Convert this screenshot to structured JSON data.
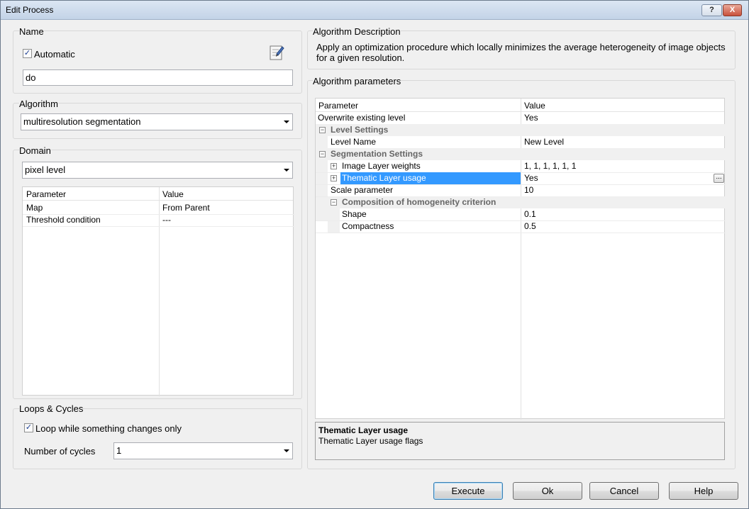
{
  "window": {
    "title": "Edit Process",
    "help_label": "?",
    "close_label": "X"
  },
  "name_section": {
    "label": "Name",
    "automatic_label": "Automatic",
    "automatic_checked": true,
    "name_value": "do",
    "edit_icon": "edit-document-icon"
  },
  "algorithm_section": {
    "label": "Algorithm",
    "selected": "multiresolution segmentation"
  },
  "domain_section": {
    "label": "Domain",
    "selected": "pixel level",
    "grid": {
      "headers": [
        "Parameter",
        "Value"
      ],
      "rows": [
        [
          "Map",
          "From Parent"
        ],
        [
          "Threshold condition",
          "---"
        ]
      ]
    }
  },
  "loops_section": {
    "label": "Loops & Cycles",
    "loop_label": "Loop while something changes only",
    "loop_checked": true,
    "cycles_label": "Number of cycles",
    "cycles_value": "1"
  },
  "description_section": {
    "label": "Algorithm Description",
    "text": "Apply an optimization procedure which locally minimizes the average heterogeneity of image objects for a given resolution."
  },
  "parameters_section": {
    "label": "Algorithm parameters",
    "headers": [
      "Parameter",
      "Value"
    ],
    "rows": [
      {
        "name": "Overwrite existing level",
        "value": "Yes"
      },
      {
        "name": "Level Settings",
        "value": ""
      },
      {
        "name": "Level Name",
        "value": "New Level"
      },
      {
        "name": "Segmentation Settings",
        "value": ""
      },
      {
        "name": "Image Layer weights",
        "value": "1, 1, 1, 1, 1, 1"
      },
      {
        "name": "Thematic Layer usage",
        "value": "Yes"
      },
      {
        "name": "Scale parameter",
        "value": "10"
      },
      {
        "name": "Composition of homogeneity criterion",
        "value": ""
      },
      {
        "name": "Shape",
        "value": "0.1"
      },
      {
        "name": "Compactness",
        "value": "0.5"
      }
    ],
    "selected_row": "Thematic Layer usage",
    "ellipsis_label": "...",
    "help_title": "Thematic Layer usage",
    "help_text": "Thematic Layer usage flags"
  },
  "buttons": {
    "execute": "Execute",
    "ok": "Ok",
    "cancel": "Cancel",
    "help": "Help"
  }
}
